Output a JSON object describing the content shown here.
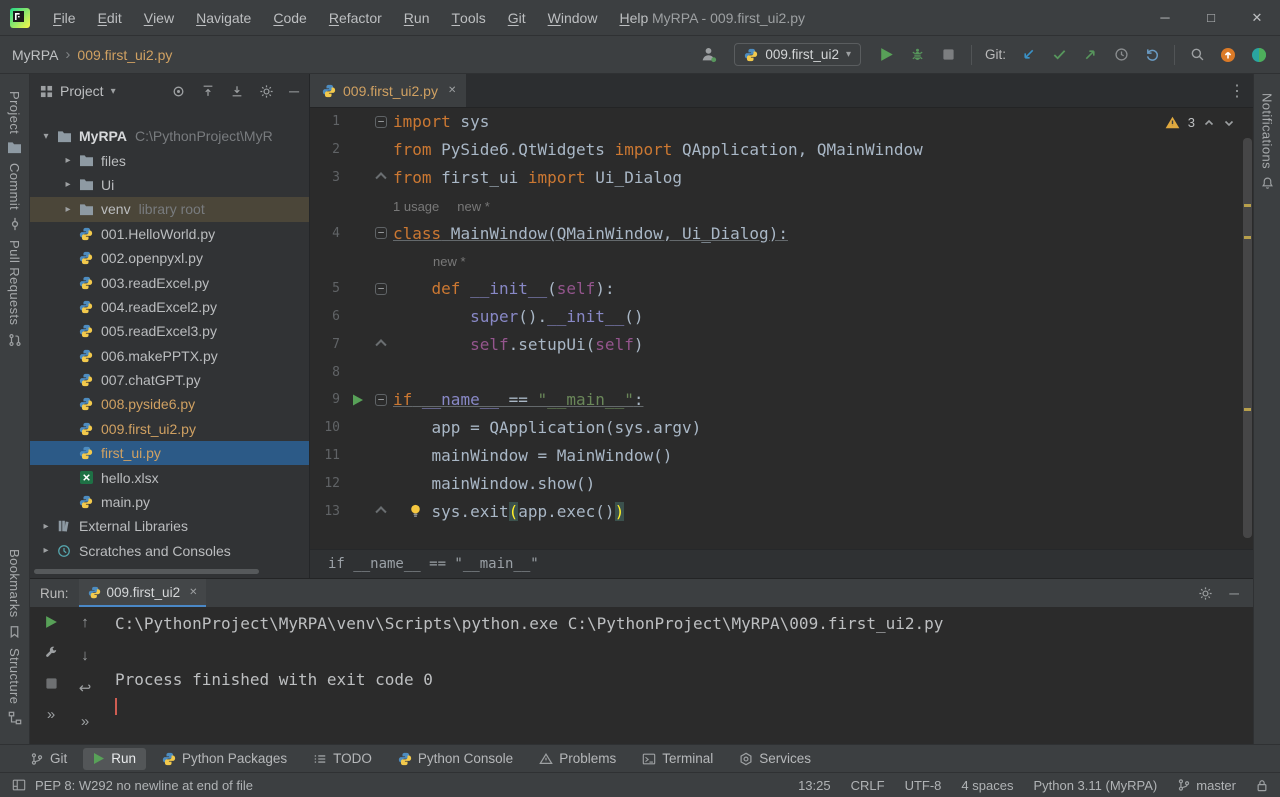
{
  "colors": {
    "panel_bg": "#3c3f41",
    "editor_bg": "#2b2b2b",
    "accent_blue": "#4A88C7",
    "selection_blue": "#2c5a87",
    "modified_file_orange": "#D0A162",
    "keyword_orange": "#cc7832",
    "string_green": "#6a8759",
    "warning_yellow": "#E0A93F",
    "run_green": "#57965C"
  },
  "title_bar": {
    "menus": [
      "File",
      "Edit",
      "View",
      "Navigate",
      "Code",
      "Refactor",
      "Run",
      "Tools",
      "Git",
      "Window",
      "Help"
    ],
    "title": "MyRPA - 009.first_ui2.py",
    "window_icons": [
      "minimize",
      "maximize",
      "close"
    ]
  },
  "toolbar": {
    "project_name": "MyRPA",
    "file_breadcrumb": "009.first_ui2.py",
    "run_config": "009.first_ui2",
    "git_label": "Git:",
    "icons": [
      "profile",
      "run",
      "debug",
      "stop",
      "update-project",
      "commit",
      "push",
      "history",
      "rollback",
      "search-everywhere",
      "update-available",
      "ai-assistant"
    ]
  },
  "left_stripe": {
    "top": [
      {
        "label": "Project",
        "icon": "folder"
      },
      {
        "label": "Commit",
        "icon": "commit"
      },
      {
        "label": "Pull Requests",
        "icon": "pr"
      }
    ],
    "bottom": [
      {
        "label": "Bookmarks",
        "icon": "bookmark"
      },
      {
        "label": "Structure",
        "icon": "structure"
      }
    ]
  },
  "right_stripe": {
    "top": [
      {
        "label": "Notifications",
        "icon": "bell"
      }
    ]
  },
  "project_panel": {
    "header": "Project",
    "header_icons": [
      "locate-file",
      "expand-all",
      "collapse-all",
      "settings",
      "hide"
    ],
    "tree": [
      {
        "depth": 0,
        "chevron": "down",
        "icon": "folder",
        "label": "MyRPA",
        "bold": true,
        "suffix": "C:\\PythonProject\\MyR"
      },
      {
        "depth": 1,
        "chevron": "right",
        "icon": "folder",
        "label": "files"
      },
      {
        "depth": 1,
        "chevron": "right",
        "icon": "folder",
        "label": "Ui"
      },
      {
        "depth": 1,
        "chevron": "right",
        "icon": "folder",
        "label": "venv",
        "suffix": "library root",
        "bg": "venv"
      },
      {
        "depth": 1,
        "icon": "python",
        "label": "001.HelloWorld.py"
      },
      {
        "depth": 1,
        "icon": "python",
        "label": "002.openpyxl.py"
      },
      {
        "depth": 1,
        "icon": "python",
        "label": "003.readExcel.py"
      },
      {
        "depth": 1,
        "icon": "python",
        "label": "004.readExcel2.py"
      },
      {
        "depth": 1,
        "icon": "python",
        "label": "005.readExcel3.py"
      },
      {
        "depth": 1,
        "icon": "python",
        "label": "006.makePPTX.py"
      },
      {
        "depth": 1,
        "icon": "python",
        "label": "007.chatGPT.py"
      },
      {
        "depth": 1,
        "icon": "python",
        "label": "008.pyside6.py",
        "color": "orange"
      },
      {
        "depth": 1,
        "icon": "python",
        "label": "009.first_ui2.py",
        "color": "orange"
      },
      {
        "depth": 1,
        "icon": "python",
        "label": "first_ui.py",
        "color": "orange",
        "bg": "selected"
      },
      {
        "depth": 1,
        "icon": "excel",
        "label": "hello.xlsx"
      },
      {
        "depth": 1,
        "icon": "python",
        "label": "main.py"
      },
      {
        "depth": 0,
        "chevron": "right",
        "icon": "libs",
        "label": "External Libraries"
      },
      {
        "depth": 0,
        "chevron": "right",
        "icon": "scratch",
        "label": "Scratches and Consoles"
      }
    ]
  },
  "editor": {
    "tab": "009.first_ui2.py",
    "warning_count": "3",
    "breadcrumb": "if __name__ == \"__main__\"",
    "lines": [
      {
        "n": "1",
        "g": "fold",
        "seg": [
          [
            "import",
            "k"
          ],
          [
            " sys",
            "p"
          ]
        ]
      },
      {
        "n": "2",
        "seg": [
          [
            "from",
            "k"
          ],
          [
            " PySide6.QtWidgets ",
            "p"
          ],
          [
            "import",
            "k"
          ],
          [
            " QApplication, QMainWindow",
            "p"
          ]
        ]
      },
      {
        "n": "3",
        "g": "foldend",
        "seg": [
          [
            "from",
            "k"
          ],
          [
            " first_ui ",
            "p"
          ],
          [
            "import",
            "k"
          ],
          [
            " Ui_Dialog",
            "p"
          ]
        ]
      },
      {
        "hint": true,
        "pad": 0,
        "seg": [
          [
            "1 usage",
            "h"
          ],
          [
            "new *",
            "h"
          ]
        ]
      },
      {
        "n": "4",
        "g": "fold",
        "u": true,
        "seg": [
          [
            "class",
            "k"
          ],
          [
            " MainWindow(QMainWindow, Ui_Dialog):",
            "p"
          ]
        ]
      },
      {
        "hint": true,
        "pad": 40,
        "seg": [
          [
            "new *",
            "h"
          ]
        ]
      },
      {
        "n": "5",
        "g": "fold",
        "seg": [
          [
            "    ",
            "p"
          ],
          [
            "def",
            "k"
          ],
          [
            " ",
            "p"
          ],
          [
            "__init__",
            "d"
          ],
          [
            "(",
            "p"
          ],
          [
            "self",
            "f"
          ],
          [
            "):",
            "p"
          ]
        ]
      },
      {
        "n": "6",
        "seg": [
          [
            "        ",
            "p"
          ],
          [
            "super",
            "b"
          ],
          [
            "().",
            "p"
          ],
          [
            "__init__",
            "d"
          ],
          [
            "()",
            "p"
          ]
        ]
      },
      {
        "n": "7",
        "g": "foldend",
        "seg": [
          [
            "        ",
            "p"
          ],
          [
            "self",
            "f"
          ],
          [
            ".setupUi(",
            "p"
          ],
          [
            "self",
            "f"
          ],
          [
            ")",
            "p"
          ]
        ]
      },
      {
        "n": "8",
        "seg": []
      },
      {
        "n": "9",
        "g": "runfold",
        "u": true,
        "seg": [
          [
            "if",
            "k"
          ],
          [
            " ",
            "p"
          ],
          [
            "__name__",
            "d"
          ],
          [
            " == ",
            "p"
          ],
          [
            "\"__main__\"",
            "s"
          ],
          [
            ":",
            "p"
          ]
        ]
      },
      {
        "n": "10",
        "seg": [
          [
            "    app = QApplication(sys.argv)",
            "p"
          ]
        ]
      },
      {
        "n": "11",
        "seg": [
          [
            "    mainWindow = MainWindow()",
            "p"
          ]
        ]
      },
      {
        "n": "12",
        "seg": [
          [
            "    mainWindow.show()",
            "p"
          ]
        ]
      },
      {
        "n": "13",
        "g": "foldend",
        "bulb": true,
        "seg": [
          [
            "    sys.exit",
            "p"
          ],
          [
            "(",
            "m"
          ],
          [
            "app.exec()",
            "p"
          ],
          [
            ")",
            "m"
          ]
        ]
      }
    ]
  },
  "run_panel": {
    "label": "Run:",
    "tab": "009.first_ui2",
    "toolbar_icons": [
      "rerun",
      "edit-configuration",
      "stop",
      "more",
      "up-stack",
      "down-stack",
      "soft-wrap",
      "more"
    ],
    "console": [
      "C:\\PythonProject\\MyRPA\\venv\\Scripts\\python.exe C:\\PythonProject\\MyRPA\\009.first_ui2.py",
      "",
      "Process finished with exit code 0"
    ]
  },
  "bottom_bar": {
    "active": "Run",
    "tabs": [
      {
        "label": "Git",
        "icon": "branch"
      },
      {
        "label": "Run",
        "icon": "play"
      },
      {
        "label": "Python Packages",
        "icon": "python"
      },
      {
        "label": "TODO",
        "icon": "todo"
      },
      {
        "label": "Python Console",
        "icon": "python"
      },
      {
        "label": "Problems",
        "icon": "problems"
      },
      {
        "label": "Terminal",
        "icon": "terminal"
      },
      {
        "label": "Services",
        "icon": "services"
      }
    ]
  },
  "status_bar": {
    "message": "PEP 8: W292 no newline at end of file",
    "items": [
      "13:25",
      "CRLF",
      "UTF-8",
      "4 spaces",
      "Python 3.11 (MyRPA)"
    ],
    "branch": "master"
  }
}
